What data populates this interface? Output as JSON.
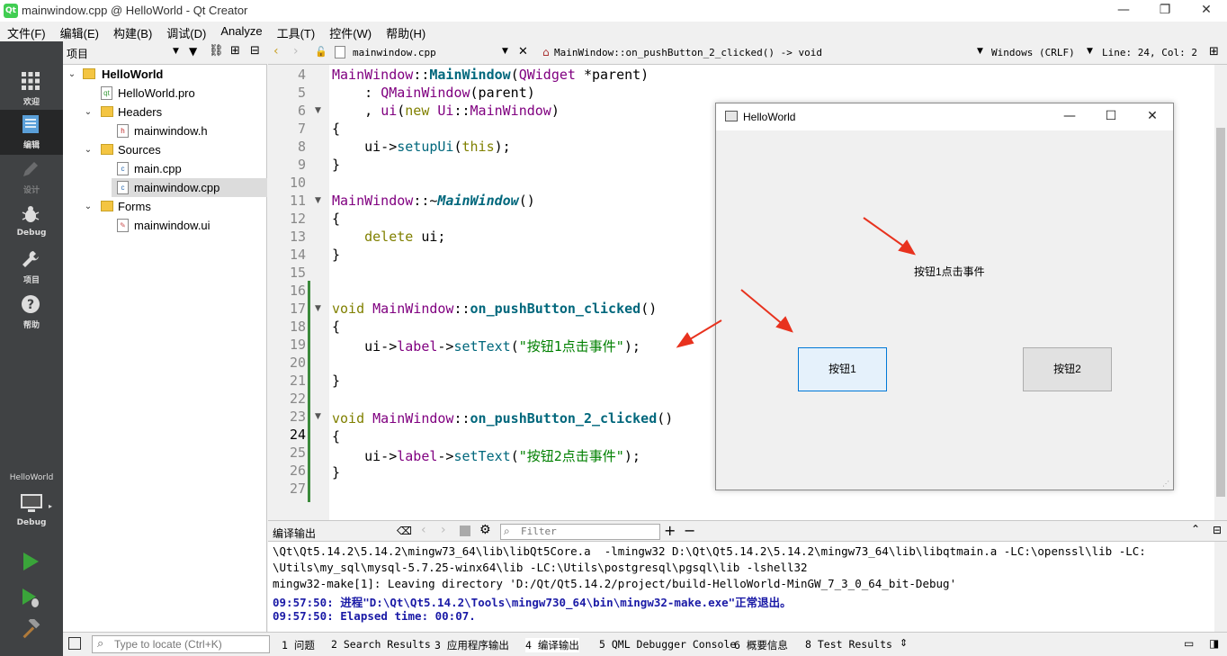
{
  "window": {
    "title": "mainwindow.cpp @ HelloWorld - Qt Creator",
    "app_icon": "Qt"
  },
  "menu": [
    "文件(F)",
    "编辑(E)",
    "构建(B)",
    "调试(D)",
    "Analyze",
    "工具(T)",
    "控件(W)",
    "帮助(H)"
  ],
  "modes": [
    {
      "label": "欢迎",
      "icon": "grid-icon"
    },
    {
      "label": "编辑",
      "icon": "edit-doc-icon"
    },
    {
      "label": "设计",
      "icon": "pencil-icon"
    },
    {
      "label": "Debug",
      "icon": "bug-icon"
    },
    {
      "label": "项目",
      "icon": "wrench-icon"
    },
    {
      "label": "帮助",
      "icon": "help-icon"
    }
  ],
  "kit": {
    "project": "HelloWorld",
    "config": "Debug"
  },
  "project_pane": {
    "selector": "项目",
    "tree": [
      {
        "label": "HelloWorld"
      },
      {
        "label": "HelloWorld.pro"
      },
      {
        "label": "Headers"
      },
      {
        "label": "mainwindow.h"
      },
      {
        "label": "Sources"
      },
      {
        "label": "main.cpp"
      },
      {
        "label": "mainwindow.cpp"
      },
      {
        "label": "Forms"
      },
      {
        "label": "mainwindow.ui"
      }
    ]
  },
  "editor_toolbar": {
    "file": "mainwindow.cpp",
    "function": "MainWindow::on_pushButton_2_clicked() -> void",
    "line_ending": "Windows (CRLF)",
    "position": "Line: 24, Col: 2"
  },
  "editor": {
    "line_numbers": [
      "4",
      "5",
      "6",
      "7",
      "8",
      "9",
      "10",
      "11",
      "12",
      "13",
      "14",
      "15",
      "16",
      "17",
      "18",
      "19",
      "20",
      "21",
      "22",
      "23",
      "24",
      "25",
      "26",
      "27"
    ],
    "code": {
      "l4a": "MainWindow",
      "l4b": "::",
      "l4c": "MainWindow",
      "l4d": "(",
      "l4e": "QWidget",
      "l4f": " *parent)",
      "l5a": "    : ",
      "l5b": "QMainWindow",
      "l5c": "(parent)",
      "l6a": "    , ",
      "l6b": "ui",
      "l6c": "(",
      "l6d": "new",
      "l6e": " ",
      "l6f": "Ui",
      "l6g": "::",
      "l6h": "MainWindow",
      "l6i": ")",
      "l7": "{",
      "l8a": "    ui->",
      "l8b": "setupUi",
      "l8c": "(",
      "l8d": "this",
      "l8e": ");",
      "l9": "}",
      "l11a": "MainWindow",
      "l11b": "::~",
      "l11c": "MainWindow",
      "l11d": "()",
      "l12": "{",
      "l13a": "    ",
      "l13b": "delete",
      "l13c": " ui;",
      "l14": "}",
      "l17a": "void",
      "l17b": " ",
      "l17c": "MainWindow",
      "l17d": "::",
      "l17e": "on_pushButton_clicked",
      "l17f": "()",
      "l18": "{",
      "l19a": "    ui->",
      "l19b": "label",
      "l19c": "->",
      "l19d": "setText",
      "l19e": "(",
      "l19f": "\"按钮1点击事件\"",
      "l19g": ");",
      "l21": "}",
      "l23a": "void",
      "l23b": " ",
      "l23c": "MainWindow",
      "l23d": "::",
      "l23e": "on_pushButton_2_clicked",
      "l23f": "()",
      "l24": "{",
      "l25a": "    ui->",
      "l25b": "label",
      "l25c": "->",
      "l25d": "setText",
      "l25e": "(",
      "l25f": "\"按钮2点击事件\"",
      "l25g": ");",
      "l26": "}"
    }
  },
  "app_window": {
    "title": "HelloWorld",
    "label": "按钮1点击事件",
    "button1": "按钮1",
    "button2": "按钮2"
  },
  "output": {
    "title": "编译输出",
    "filter_placeholder": "Filter",
    "lines": [
      "\\Qt\\Qt5.14.2\\5.14.2\\mingw73_64\\lib\\libQt5Core.a  -lmingw32 D:\\Qt\\Qt5.14.2\\5.14.2\\mingw73_64\\lib\\libqtmain.a -LC:\\openssl\\lib -LC:",
      "\\Utils\\my_sql\\mysql-5.7.25-winx64\\lib -LC:\\Utils\\postgresql\\pgsql\\lib -lshell32",
      "mingw32-make[1]: Leaving directory 'D:/Qt/Qt5.14.2/project/build-HelloWorld-MinGW_7_3_0_64_bit-Debug'",
      "09:57:50: 进程\"D:\\Qt\\Qt5.14.2\\Tools\\mingw730_64\\bin\\mingw32-make.exe\"正常退出。",
      "09:57:50: Elapsed time: 00:07."
    ]
  },
  "statusbar": {
    "locate_placeholder": "Type to locate (Ctrl+K)",
    "tabs": [
      "1 问题",
      "2 Search Results",
      "3 应用程序输出",
      "4 编译输出",
      "5 QML Debugger Console",
      "6 概要信息",
      "8 Test Results"
    ]
  },
  "colors": {
    "accent_arrow": "#e8321e",
    "mode_bar": "#404244",
    "run_green": "#3aa53a"
  }
}
